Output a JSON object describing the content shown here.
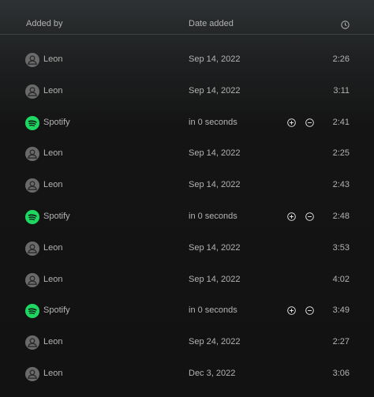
{
  "header": {
    "added_by": "Added by",
    "date_added": "Date added",
    "duration_icon": "clock-icon"
  },
  "rows": [
    {
      "added_by": "Leon",
      "avatar": "user-icon",
      "date": "Sep 14, 2022",
      "duration": "2:26",
      "actions": false
    },
    {
      "added_by": "Leon",
      "avatar": "user-icon",
      "date": "Sep 14, 2022",
      "duration": "3:11",
      "actions": false
    },
    {
      "added_by": "Spotify",
      "avatar": "spotify-icon",
      "date": "in 0 seconds",
      "duration": "2:41",
      "actions": true
    },
    {
      "added_by": "Leon",
      "avatar": "user-icon",
      "date": "Sep 14, 2022",
      "duration": "2:25",
      "actions": false
    },
    {
      "added_by": "Leon",
      "avatar": "user-icon",
      "date": "Sep 14, 2022",
      "duration": "2:43",
      "actions": false
    },
    {
      "added_by": "Spotify",
      "avatar": "spotify-icon",
      "date": "in 0 seconds",
      "duration": "2:48",
      "actions": true
    },
    {
      "added_by": "Leon",
      "avatar": "user-icon",
      "date": "Sep 14, 2022",
      "duration": "3:53",
      "actions": false
    },
    {
      "added_by": "Leon",
      "avatar": "user-icon",
      "date": "Sep 14, 2022",
      "duration": "4:02",
      "actions": false
    },
    {
      "added_by": "Spotify",
      "avatar": "spotify-icon",
      "date": "in 0 seconds",
      "duration": "3:49",
      "actions": true
    },
    {
      "added_by": "Leon",
      "avatar": "user-icon",
      "date": "Sep 24, 2022",
      "duration": "2:27",
      "actions": false
    },
    {
      "added_by": "Leon",
      "avatar": "user-icon",
      "date": "Dec 3, 2022",
      "duration": "3:06",
      "actions": false
    }
  ],
  "colors": {
    "spotify_green": "#1ed760",
    "text_secondary": "#b3b3b3",
    "background": "#121212"
  }
}
